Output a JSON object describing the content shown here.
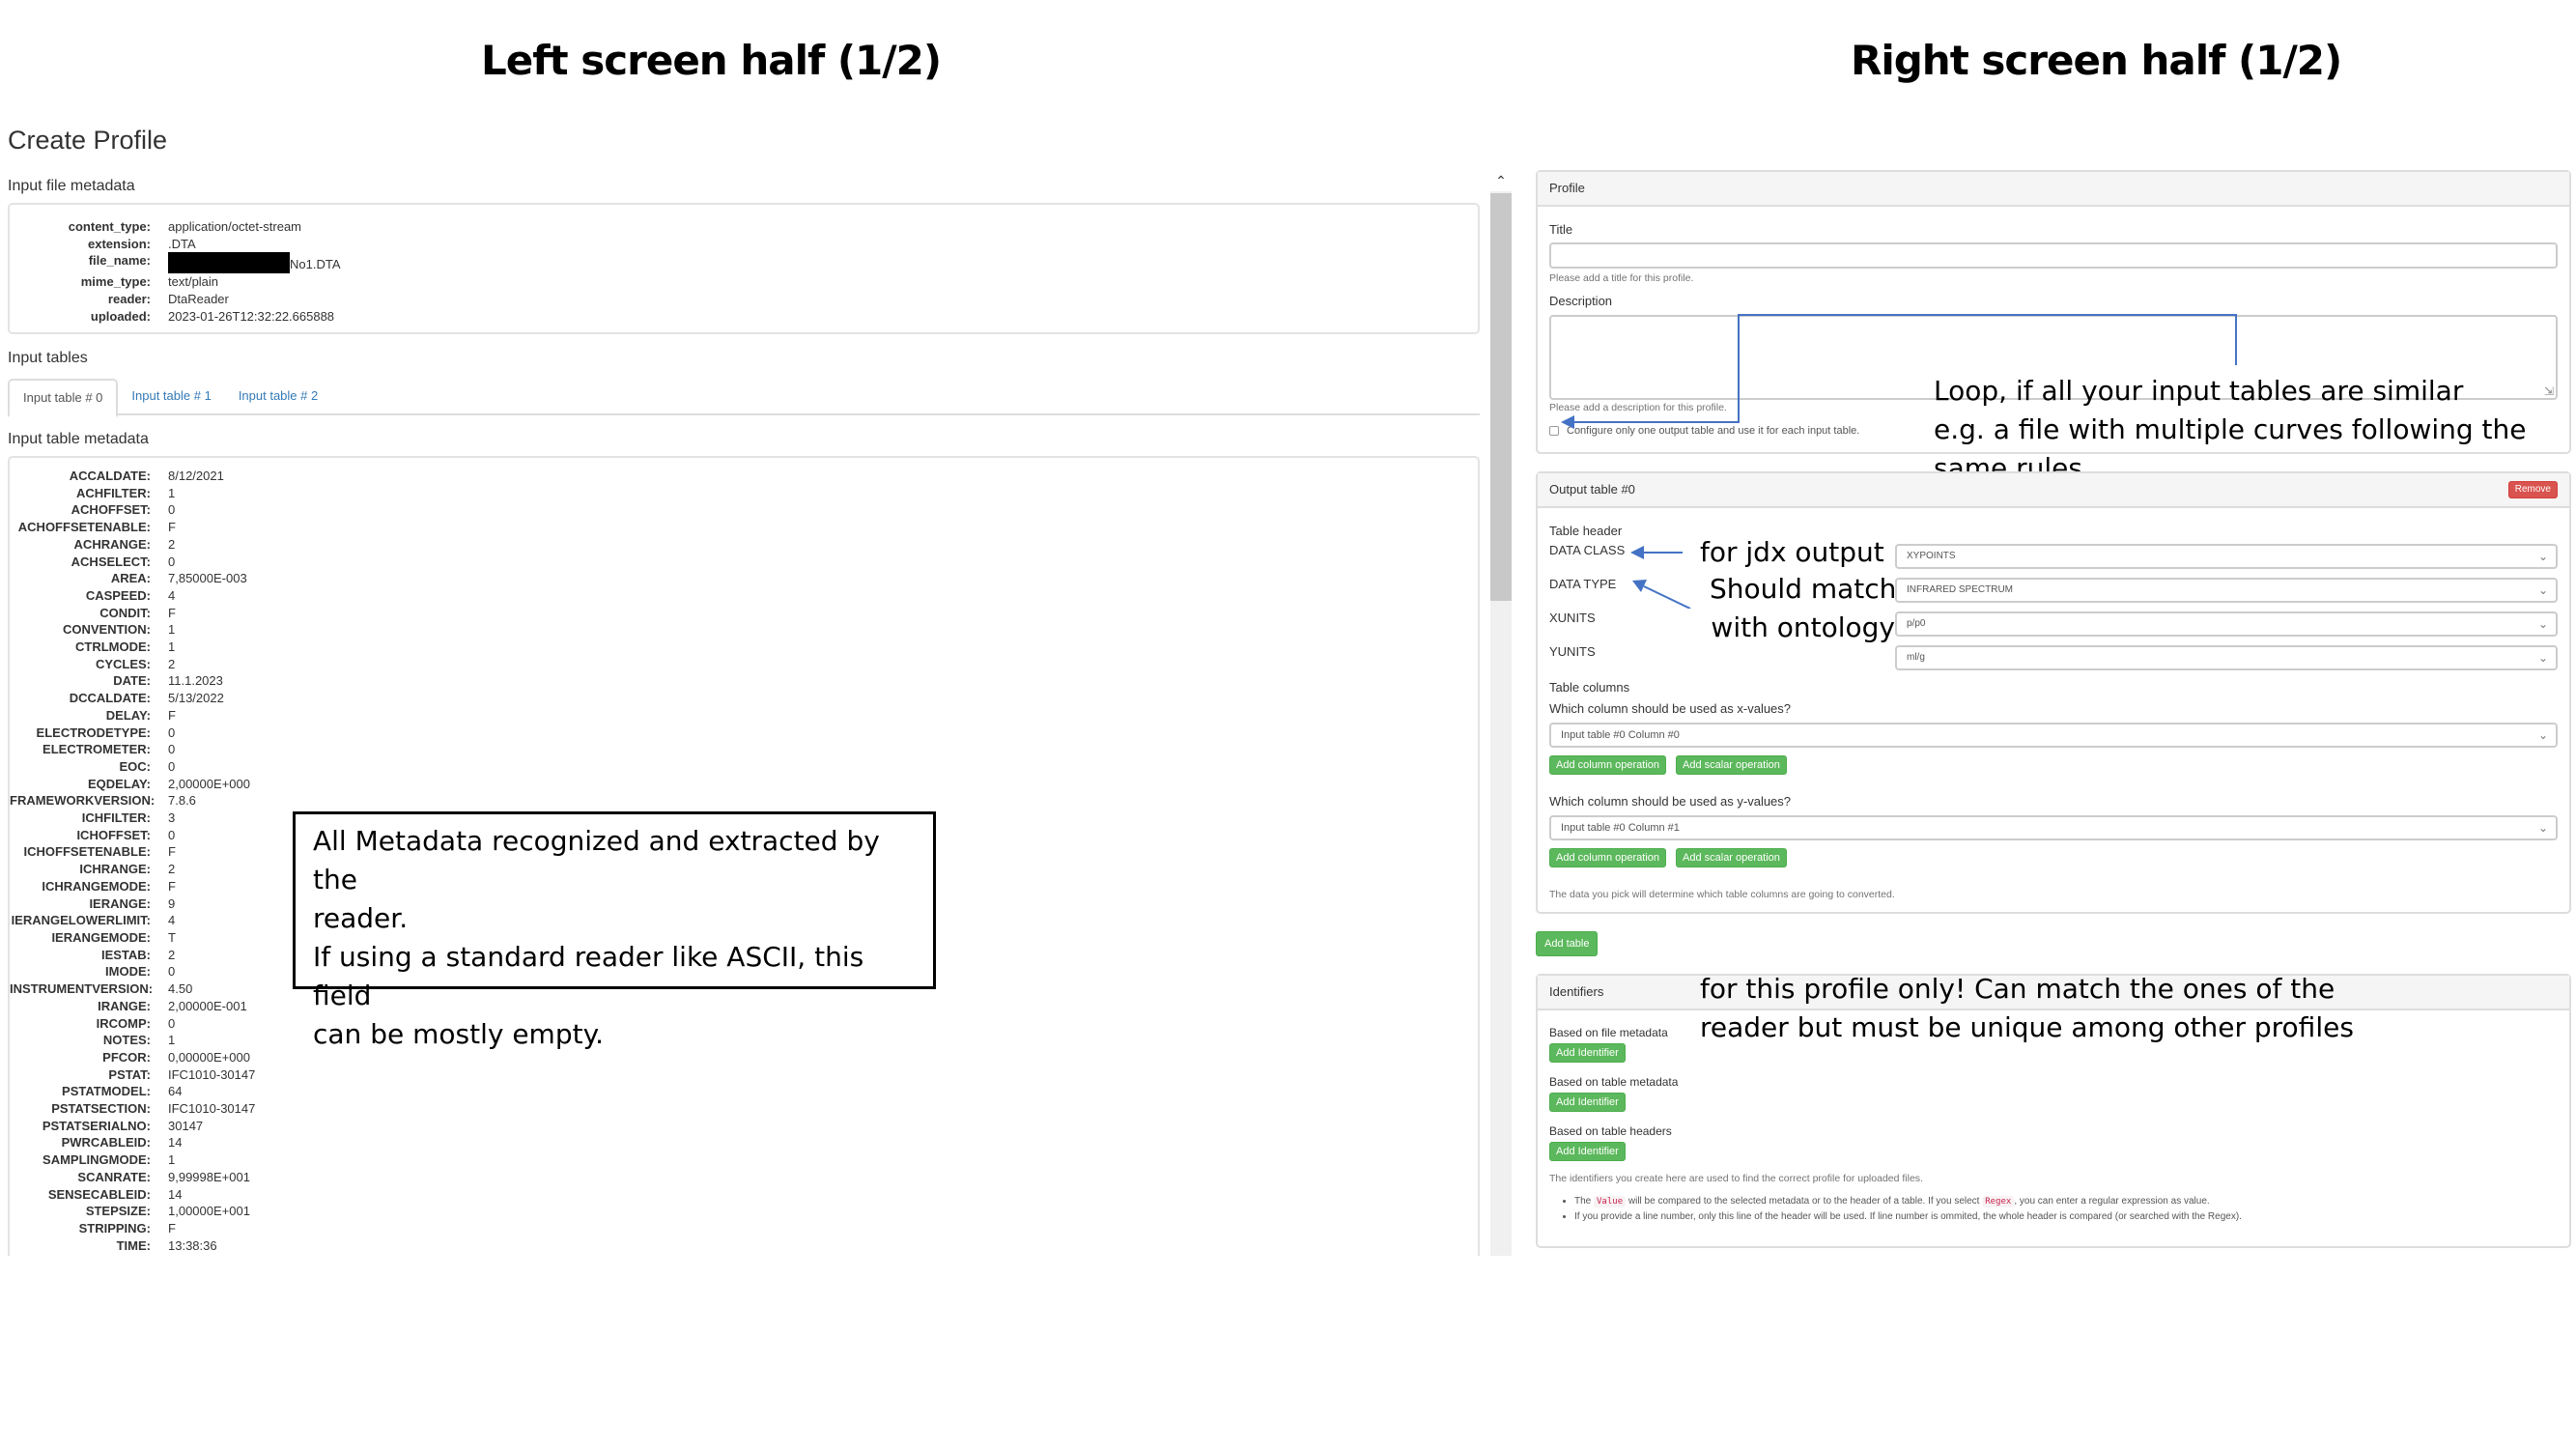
{
  "slide": {
    "left_title": "Left screen half (1/2)",
    "right_title": "Right screen half (1/2)"
  },
  "app": {
    "page_title": "Create Profile"
  },
  "file_metadata": {
    "label": "Input file metadata",
    "rows": [
      {
        "key": "content_type:",
        "value": "application/octet-stream"
      },
      {
        "key": "extension:",
        "value": ".DTA"
      },
      {
        "key": "file_name:",
        "value": "No1.DTA",
        "redacted_prefix": true
      },
      {
        "key": "mime_type:",
        "value": "text/plain"
      },
      {
        "key": "reader:",
        "value": "DtaReader"
      },
      {
        "key": "uploaded:",
        "value": "2023-01-26T12:32:22.665888"
      }
    ]
  },
  "input_tables": {
    "label": "Input tables",
    "tabs": [
      {
        "label": "Input table # 0",
        "active": true
      },
      {
        "label": "Input table # 1",
        "active": false
      },
      {
        "label": "Input table # 2",
        "active": false
      }
    ]
  },
  "table_metadata": {
    "label": "Input table metadata",
    "rows": [
      {
        "key": "ACCALDATE:",
        "value": "8/12/2021"
      },
      {
        "key": "ACHFILTER:",
        "value": "1"
      },
      {
        "key": "ACHOFFSET:",
        "value": "0"
      },
      {
        "key": "ACHOFFSETENABLE:",
        "value": "F"
      },
      {
        "key": "ACHRANGE:",
        "value": "2"
      },
      {
        "key": "ACHSELECT:",
        "value": "0"
      },
      {
        "key": "AREA:",
        "value": "7,85000E-003"
      },
      {
        "key": "CASPEED:",
        "value": "4"
      },
      {
        "key": "CONDIT:",
        "value": "F"
      },
      {
        "key": "CONVENTION:",
        "value": "1"
      },
      {
        "key": "CTRLMODE:",
        "value": "1"
      },
      {
        "key": "CYCLES:",
        "value": "2"
      },
      {
        "key": "DATE:",
        "value": "11.1.2023"
      },
      {
        "key": "DCCALDATE:",
        "value": "5/13/2022"
      },
      {
        "key": "DELAY:",
        "value": "F"
      },
      {
        "key": "ELECTRODETYPE:",
        "value": "0"
      },
      {
        "key": "ELECTROMETER:",
        "value": "0"
      },
      {
        "key": "EOC:",
        "value": "0"
      },
      {
        "key": "EQDELAY:",
        "value": "2,00000E+000"
      },
      {
        "key": "FRAMEWORKVERSION:",
        "value": "7.8.6"
      },
      {
        "key": "ICHFILTER:",
        "value": "3"
      },
      {
        "key": "ICHOFFSET:",
        "value": "0"
      },
      {
        "key": "ICHOFFSETENABLE:",
        "value": "F"
      },
      {
        "key": "ICHRANGE:",
        "value": "2"
      },
      {
        "key": "ICHRANGEMODE:",
        "value": "F"
      },
      {
        "key": "IERANGE:",
        "value": "9"
      },
      {
        "key": "IERANGELOWERLIMIT:",
        "value": "4"
      },
      {
        "key": "IERANGEMODE:",
        "value": "T"
      },
      {
        "key": "IESTAB:",
        "value": "2"
      },
      {
        "key": "IMODE:",
        "value": "0"
      },
      {
        "key": "INSTRUMENTVERSION:",
        "value": "4.50"
      },
      {
        "key": "IRANGE:",
        "value": "2,00000E-001"
      },
      {
        "key": "IRCOMP:",
        "value": "0"
      },
      {
        "key": "NOTES:",
        "value": "1"
      },
      {
        "key": "PFCOR:",
        "value": "0,00000E+000"
      },
      {
        "key": "PSTAT:",
        "value": "IFC1010-30147"
      },
      {
        "key": "PSTATMODEL:",
        "value": "64"
      },
      {
        "key": "PSTATSECTION:",
        "value": "IFC1010-30147"
      },
      {
        "key": "PSTATSERIALNO:",
        "value": "30147"
      },
      {
        "key": "PWRCABLEID:",
        "value": "14"
      },
      {
        "key": "SAMPLINGMODE:",
        "value": "1"
      },
      {
        "key": "SCANRATE:",
        "value": "9,99998E+001"
      },
      {
        "key": "SENSECABLEID:",
        "value": "14"
      },
      {
        "key": "STEPSIZE:",
        "value": "1,00000E+001"
      },
      {
        "key": "STRIPPING:",
        "value": "F"
      },
      {
        "key": "TIME:",
        "value": "13:38:36"
      }
    ]
  },
  "annotations": {
    "metadata_note": [
      "All Metadata recognized and extracted by the",
      "reader.",
      "If using a standard reader like ASCII, this field",
      "can be mostly empty."
    ],
    "loop_note": [
      "Loop, if all your input tables are similar",
      "e.g. a file with multiple curves following the",
      "same rules"
    ],
    "jdx_note": "for jdx output",
    "ontology_note": [
      "Should match",
      "with ontology"
    ],
    "identifiers_note": [
      "for this profile only! Can match the ones of the",
      "reader but must be unique among other profiles"
    ]
  },
  "profile": {
    "heading": "Profile",
    "title_label": "Title",
    "title_value": "",
    "title_help": "Please add a title for this profile.",
    "description_label": "Description",
    "description_value": "",
    "description_help": "Please add a description for this profile.",
    "single_table_checkbox": {
      "label": "Configure only one output table and use it for each input table.",
      "checked": false
    }
  },
  "output_table": {
    "heading": "Output table #0",
    "remove_label": "Remove",
    "header_label": "Table header",
    "fields": [
      {
        "label": "DATA CLASS",
        "value": "XYPOINTS"
      },
      {
        "label": "DATA TYPE",
        "value": "INFRARED SPECTRUM"
      },
      {
        "label": "XUNITS",
        "value": "p/p0"
      },
      {
        "label": "YUNITS",
        "value": "ml/g"
      }
    ],
    "columns_label": "Table columns",
    "x_question": "Which column should be used as x-values?",
    "x_value": "Input table #0 Column #0",
    "y_question": "Which column should be used as y-values?",
    "y_value": "Input table #0 Column #1",
    "add_column_op": "Add column operation",
    "add_scalar_op": "Add scalar operation",
    "columns_help": "The data you pick will determine which table columns are going to converted."
  },
  "add_table_label": "Add table",
  "identifiers": {
    "heading": "Identifiers",
    "groups": [
      {
        "label": "Based on file metadata",
        "button": "Add Identifier"
      },
      {
        "label": "Based on table metadata",
        "button": "Add Identifier"
      },
      {
        "label": "Based on table headers",
        "button": "Add Identifier"
      }
    ],
    "help": "The identifiers you create here are used to find the correct profile for uploaded files.",
    "note1_a": "The",
    "note1_code1": "Value",
    "note1_b": "will be compared to the selected metadata or to the header of a table. If you select",
    "note1_code2": "Regex",
    "note1_c": ", you can enter a regular expression as value.",
    "note2": "If you provide a line number, only this line of the header will be used. If line number is ommited, the whole header is compared (or searched with the Regex)."
  },
  "colors": {
    "primary_link": "#337ab7",
    "success": "#5cb85c",
    "danger": "#d9534f",
    "arrow": "#4472c4"
  }
}
